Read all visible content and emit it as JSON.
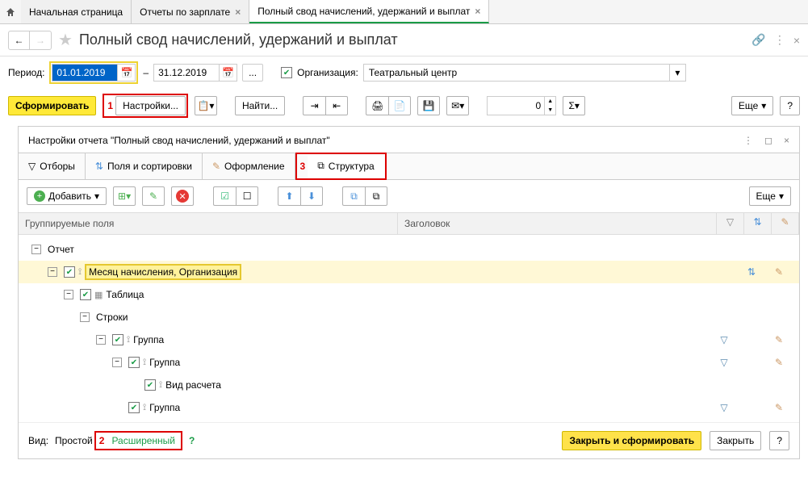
{
  "tabs": {
    "home": "Начальная страница",
    "t1": "Отчеты по зарплате",
    "t2": "Полный свод начислений, удержаний и выплат"
  },
  "title": "Полный свод начислений, удержаний и выплат",
  "period": {
    "label": "Период:",
    "start": "01.01.2019",
    "end": "31.12.2019",
    "dash": "–"
  },
  "org": {
    "chk_on": true,
    "label": "Организация:",
    "value": "Театральный центр"
  },
  "toolbar": {
    "form": "Сформировать",
    "settings": "Настройки...",
    "find": "Найти...",
    "more": "Еще",
    "help": "?",
    "spin": "0",
    "sigma": "Σ"
  },
  "marks": {
    "m1": "1",
    "m2": "2",
    "m3": "3"
  },
  "panel": {
    "title": "Настройки отчета \"Полный свод начислений, удержаний и выплат\"",
    "tabs": {
      "filters": "Отборы",
      "fields": "Поля и сортировки",
      "format": "Оформление",
      "struct": "Структура"
    },
    "add": "Добавить",
    "more": "Еще",
    "cols": {
      "group": "Группируемые поля",
      "header": "Заголовок"
    },
    "tree": {
      "report": "Отчет",
      "month_org": "Месяц начисления, Организация",
      "table": "Таблица",
      "rows": "Строки",
      "group": "Группа",
      "calc_type": "Вид расчета"
    }
  },
  "footer": {
    "view": "Вид:",
    "simple": "Простой",
    "ext": "Расширенный",
    "close_form": "Закрыть и сформировать",
    "close": "Закрыть",
    "help": "?"
  }
}
